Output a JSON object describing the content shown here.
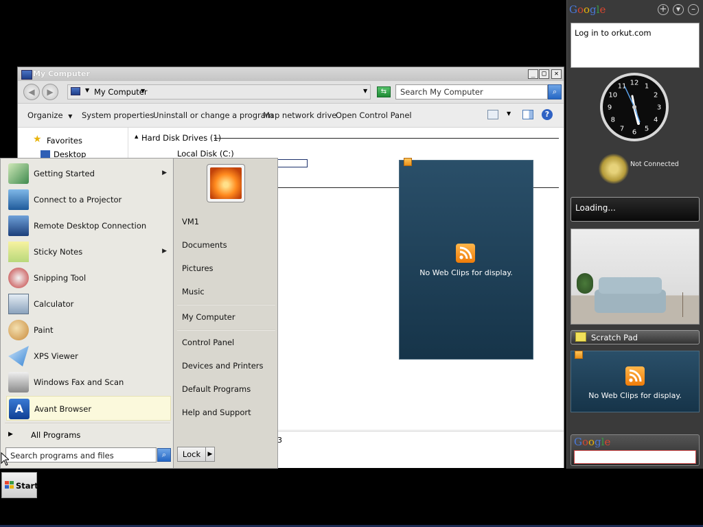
{
  "window": {
    "title": "My Computer",
    "address_label": "My Computer",
    "search_placeholder": "Search My Computer",
    "toolbar": {
      "organize": "Organize",
      "system_properties": "System properties",
      "uninstall": "Uninstall or change a program",
      "map_drive": "Map network drive",
      "control_panel": "Open Control Panel"
    },
    "nav": {
      "favorites": "Favorites",
      "desktop": "Desktop"
    },
    "section_header": "Hard Disk Drives (1)",
    "drive_label": "Local Disk (C:)",
    "drive_usage_fraction": 0.4,
    "details_fragment": "3"
  },
  "start_menu": {
    "programs": [
      {
        "label": "Getting Started",
        "icon": "getting-started-icon",
        "submenu": true
      },
      {
        "label": "Connect to a Projector",
        "icon": "projector-icon",
        "submenu": false
      },
      {
        "label": "Remote Desktop Connection",
        "icon": "remote-desktop-icon",
        "submenu": false
      },
      {
        "label": "Sticky Notes",
        "icon": "sticky-notes-icon",
        "submenu": true
      },
      {
        "label": "Snipping Tool",
        "icon": "snipping-tool-icon",
        "submenu": false
      },
      {
        "label": "Calculator",
        "icon": "calculator-icon",
        "submenu": false
      },
      {
        "label": "Paint",
        "icon": "paint-icon",
        "submenu": false
      },
      {
        "label": "XPS Viewer",
        "icon": "xps-viewer-icon",
        "submenu": false
      },
      {
        "label": "Windows Fax and Scan",
        "icon": "fax-scan-icon",
        "submenu": false
      },
      {
        "label": "Avant Browser",
        "icon": "avant-browser-icon",
        "submenu": false
      }
    ],
    "all_programs": "All Programs",
    "search_placeholder": "Search programs and files",
    "lock_label": "Lock",
    "right_items": [
      "VM1",
      "Documents",
      "Pictures",
      "Music",
      "My Computer",
      "Control Panel",
      "Devices and Printers",
      "Default Programs",
      "Help and Support"
    ]
  },
  "taskbar": {
    "start_label": "Start"
  },
  "webclip_main": {
    "text": "No Web Clips for display."
  },
  "sidebar": {
    "google_logo": "Google",
    "orkut_text": "Log in to orkut.com",
    "clock_numbers": [
      "12",
      "1",
      "2",
      "3",
      "4",
      "5",
      "6",
      "7",
      "8",
      "9",
      "10",
      "11"
    ],
    "status_text": "Not Connected",
    "loading_text": "Loading...",
    "scratch_pad": "Scratch Pad",
    "webclip_text": "No Web Clips for display.",
    "google_search_logo": "Google"
  },
  "colors": {
    "google_blue": "#4a78d8",
    "google_red": "#d8462f",
    "google_yellow": "#e8b40c",
    "google_green": "#3a9a44"
  }
}
